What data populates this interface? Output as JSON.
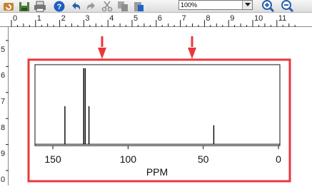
{
  "toolbar": {
    "zoom_value": "100%",
    "buttons": [
      "refresh-icon",
      "save-icon",
      "print-icon",
      "help-icon",
      "undo-icon",
      "redo-icon",
      "cut-icon",
      "copy-icon",
      "paste-icon",
      "zoom-in-icon",
      "zoom-out-icon"
    ]
  },
  "ruler": {
    "h_labels": [
      "0",
      "1",
      "2",
      "3",
      "4",
      "5",
      "6",
      "7",
      "8",
      "9",
      "10",
      "11"
    ],
    "v_labels": [
      "5",
      "6",
      "7",
      "8",
      "9",
      "0"
    ]
  },
  "annotation": {
    "arrow_color": "#e8383d",
    "box_color": "#e8383d"
  },
  "chart_data": {
    "type": "bar",
    "xlabel": "PPM",
    "xlim": [
      160,
      0
    ],
    "x_reversed": true,
    "tick_labels": [
      "150",
      "100",
      "50",
      "0"
    ],
    "tick_values": [
      150,
      100,
      50,
      0
    ],
    "peaks": [
      {
        "ppm": 142,
        "intensity": 0.5
      },
      {
        "ppm": 129.5,
        "intensity": 1.0
      },
      {
        "ppm": 128.5,
        "intensity": 1.0
      },
      {
        "ppm": 126,
        "intensity": 0.5
      },
      {
        "ppm": 43,
        "intensity": 0.25
      }
    ]
  }
}
